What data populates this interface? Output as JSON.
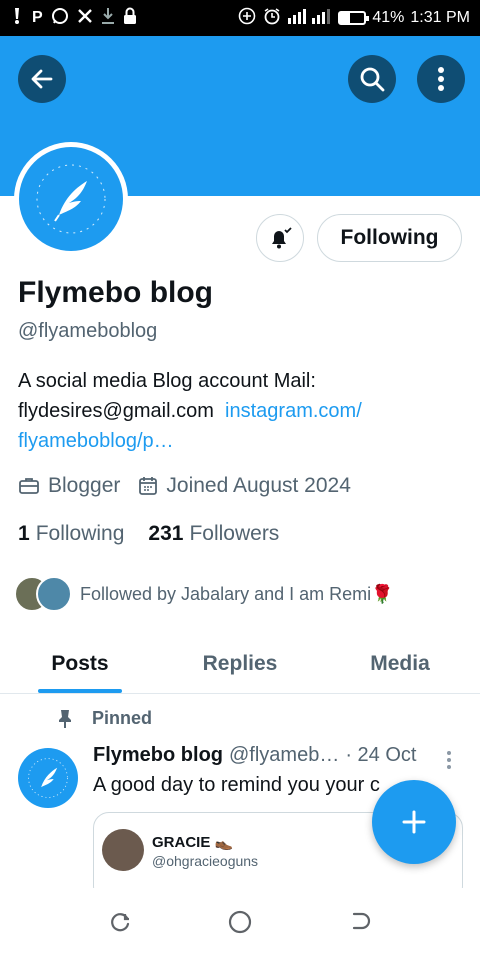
{
  "status_bar": {
    "left_icons": [
      "alert-icon",
      "p-icon",
      "whatsapp-icon",
      "x-icon",
      "download-icon",
      "lock-icon"
    ],
    "p_glyph": "P",
    "battery_percent": 41,
    "battery_text": "41%",
    "time": "1:31 PM"
  },
  "colors": {
    "accent": "#1d9bf0",
    "banner": "#1d9bf0",
    "button_dark": "#0f4d73",
    "muted": "#536471"
  },
  "header": {
    "back_icon": "arrow-left-icon",
    "search_icon": "search-icon",
    "more_icon": "more-vertical-icon"
  },
  "profile": {
    "name": "Flymebo blog",
    "handle": "@flyameboblog",
    "bio_text": "A social media Blog account Mail: flydesires@gmail.com",
    "bio_link": "instagram.com/ flyameboblog/p…",
    "job": "Blogger",
    "joined": "Joined August 2024",
    "following_count": "1",
    "following_label": "Following",
    "followers_count": "231",
    "followers_label": "Followers",
    "followed_by": "Followed by Jabalary and I am Remi🌹",
    "follow_button": "Following"
  },
  "tabs": [
    {
      "label": "Posts",
      "active": true
    },
    {
      "label": "Replies",
      "active": false
    },
    {
      "label": "Media",
      "active": false
    }
  ],
  "post": {
    "pinned_label": "Pinned",
    "author": "Flymebo blog",
    "handle": "@flyameb…",
    "date": "· 24 Oct",
    "text": "A good day to remind you your c",
    "quote": {
      "name": "GRACIE 👞",
      "handle": "@ohgracieoguns"
    }
  },
  "fab_icon": "plus-icon",
  "nav": [
    "recent-apps-icon",
    "home-icon",
    "back-icon"
  ]
}
